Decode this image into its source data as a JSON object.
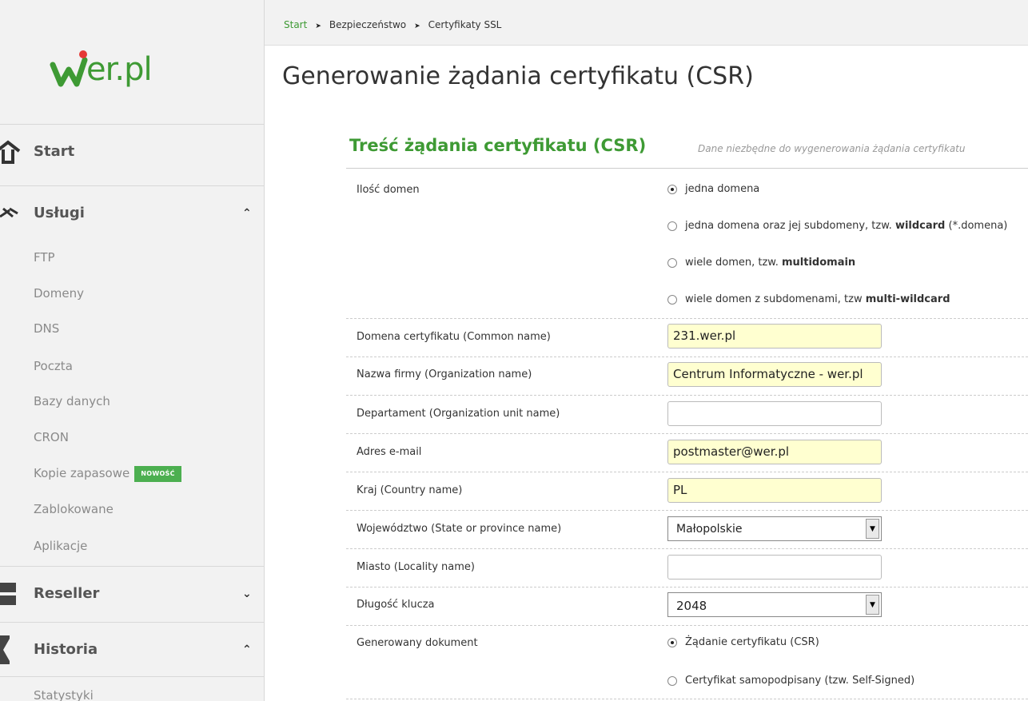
{
  "logo": {
    "text": "er.pl"
  },
  "breadcrumb": [
    "Start",
    "Bezpieczeństwo",
    "Certyfikaty SSL"
  ],
  "page_title": "Generowanie żądania certyfikatu (CSR)",
  "sidebar": {
    "start": "Start",
    "uslugi": "Usługi",
    "uslugi_items": [
      "FTP",
      "Domeny",
      "DNS",
      "Poczta",
      "Bazy danych",
      "CRON",
      "Kopie zapasowe",
      "Zablokowane",
      "Aplikacje"
    ],
    "badge": "NOWOŚĆ",
    "reseller": "Reseller",
    "historia": "Historia",
    "historia_items": [
      "Statystyki"
    ]
  },
  "form": {
    "section_title": "Treść żądania certyfikatu (CSR)",
    "section_desc": "Dane niezbędne do wygenerowania żądania certyfikatu",
    "domain_count_label": "Ilość domen",
    "domain_options": [
      {
        "text": "jedna domena",
        "selected": true
      },
      {
        "pre": "jedna domena oraz jej subdomeny, tzw. ",
        "bold": "wildcard",
        "post": " (*.domena)",
        "selected": false
      },
      {
        "pre": "wiele domen, tzw. ",
        "bold": "multidomain",
        "post": "",
        "selected": false
      },
      {
        "pre": "wiele domen z subdomenami, tzw ",
        "bold": "multi-wildcard",
        "post": "",
        "selected": false
      }
    ],
    "common_name_label": "Domena certyfikatu (Common name)",
    "common_name_value": "231.wer.pl",
    "org_label": "Nazwa firmy (Organization name)",
    "org_value": "Centrum Informatyczne - wer.pl",
    "unit_label": "Departament (Organization unit name)",
    "unit_value": "",
    "email_label": "Adres e-mail",
    "email_value": "postmaster@wer.pl",
    "country_label": "Kraj (Country name)",
    "country_value": "PL",
    "state_label": "Województwo (State or province name)",
    "state_value": "Małopolskie",
    "city_label": "Miasto (Locality name)",
    "city_value": "",
    "key_label": "Długość klucza",
    "key_value": "2048",
    "doc_label": "Generowany dokument",
    "doc_options": [
      {
        "text": "Żądanie certyfikatu (CSR)",
        "selected": true
      },
      {
        "text": "Certyfikat samopodpisany (tzw. Self-Signed)",
        "selected": false
      }
    ]
  },
  "colors": {
    "brand_green": "#3e9a34",
    "badge_green": "#4caf50",
    "input_fill": "#ffffd0"
  }
}
